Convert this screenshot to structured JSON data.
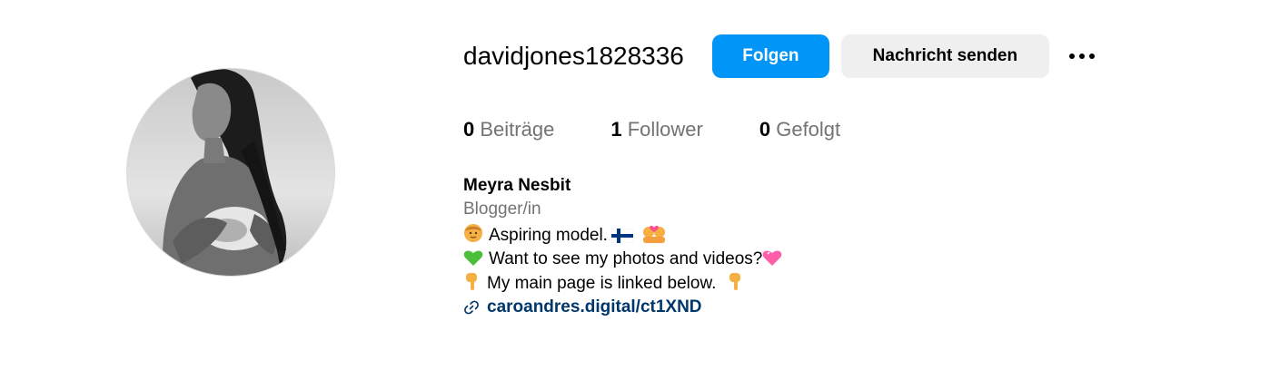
{
  "profile": {
    "username": "davidjones1828336",
    "follow_label": "Folgen",
    "message_label": "Nachricht senden",
    "more_icon": "more-options-icon"
  },
  "stats": {
    "posts_count": "0",
    "posts_label": "Beiträge",
    "followers_count": "1",
    "followers_label": "Follower",
    "following_count": "0",
    "following_label": "Gefolgt"
  },
  "bio": {
    "name": "Meyra Nesbit",
    "category": "Blogger/in",
    "line1": "Aspiring model.",
    "line2": "Want to see my photos and videos?",
    "line3": "My main page is linked below.",
    "link": "caroandres.digital/ct1XND",
    "line1_icons": [
      "person-emoji-icon",
      "finland-flag-icon",
      "couple-heart-emoji-icon"
    ],
    "line2_icons": [
      "green-heart-icon",
      "pink-heart-icon"
    ],
    "line3_icons": [
      "pointing-down-icon",
      "pointing-down-icon"
    ],
    "link_icon": "link-icon"
  },
  "colors": {
    "follow_button": "#0095f6",
    "message_button": "#efefef",
    "link": "#00376b",
    "secondary_text": "#737373"
  }
}
